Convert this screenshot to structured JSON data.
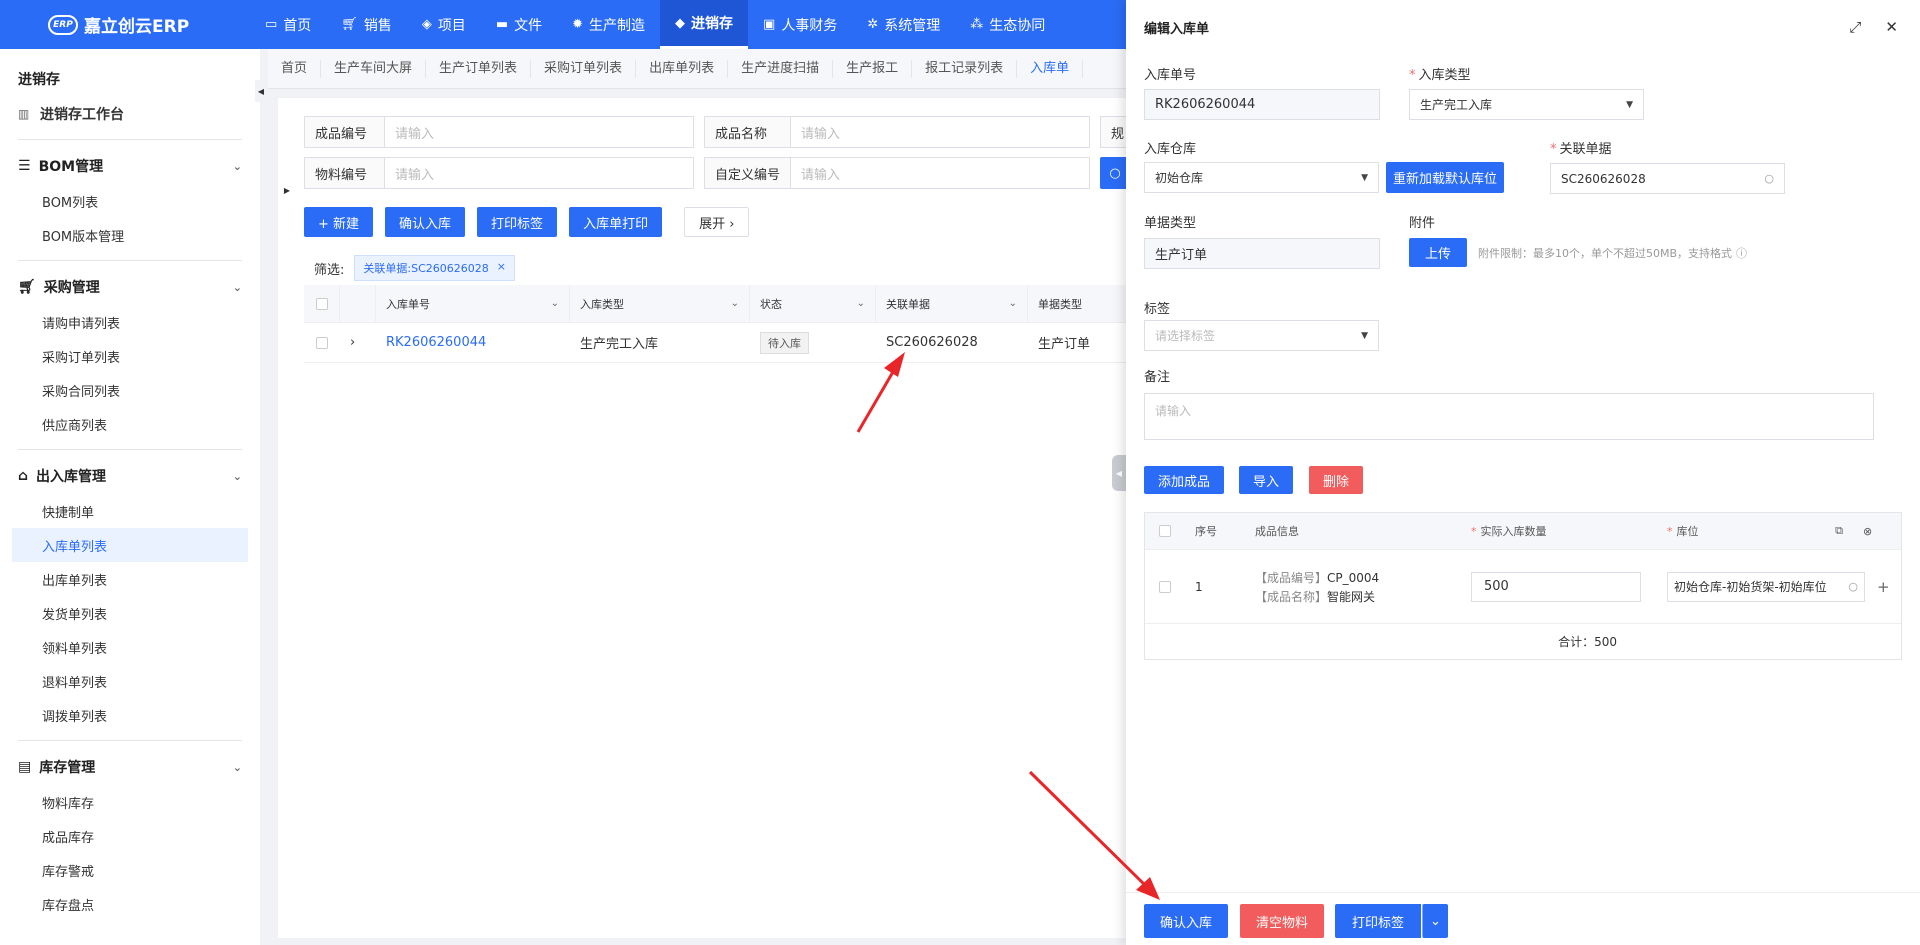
{
  "app": {
    "logo_badge": "ERP",
    "name": "嘉立创云ERP"
  },
  "topnav": [
    {
      "label": "首页",
      "icon": "monitor-icon"
    },
    {
      "label": "销售",
      "icon": "cart-icon"
    },
    {
      "label": "项目",
      "icon": "layers-icon"
    },
    {
      "label": "文件",
      "icon": "folder-icon"
    },
    {
      "label": "生产制造",
      "icon": "gear-icon"
    },
    {
      "label": "进销存",
      "icon": "box-icon",
      "active": true
    },
    {
      "label": "人事财务",
      "icon": "id-card-icon"
    },
    {
      "label": "系统管理",
      "icon": "settings-icon"
    },
    {
      "label": "生态协同",
      "icon": "nodes-icon"
    }
  ],
  "sidebar": {
    "title": "进销存",
    "workbench": "进销存工作台",
    "groups": [
      {
        "label": "BOM管理",
        "items": [
          "BOM列表",
          "BOM版本管理"
        ]
      },
      {
        "label": "采购管理",
        "items": [
          "请购申请列表",
          "采购订单列表",
          "采购合同列表",
          "供应商列表"
        ]
      },
      {
        "label": "出入库管理",
        "items": [
          "快捷制单",
          "入库单列表",
          "出库单列表",
          "发货单列表",
          "领料单列表",
          "退料单列表",
          "调拨单列表"
        ]
      },
      {
        "label": "库存管理",
        "items": [
          "物料库存",
          "成品库存",
          "库存警戒",
          "库存盘点"
        ]
      }
    ]
  },
  "tabs": [
    "首页",
    "生产车间大屏",
    "生产订单列表",
    "采购订单列表",
    "出库单列表",
    "生产进度扫描",
    "生产报工",
    "报工记录列表",
    "入库单"
  ],
  "search": {
    "product_code_label": "成品编号",
    "product_name_label": "成品名称",
    "spec_label": "规",
    "material_code_label": "物料编号",
    "custom_code_label": "自定义编号",
    "placeholder": "请输入"
  },
  "toolbar": {
    "new": "+ 新建",
    "confirm": "确认入库",
    "print_label": "打印标签",
    "print_doc": "入库单打印",
    "expand": "展开 ›"
  },
  "filter": {
    "label": "筛选:",
    "chip": "关联单据:SC260626028",
    "chip_close": "×"
  },
  "table": {
    "columns": [
      "入库单号",
      "入库类型",
      "状态",
      "关联单据",
      "单据类型"
    ],
    "rows": [
      {
        "no": "RK2606260044",
        "type": "生产完工入库",
        "status": "待入库",
        "related": "SC260626028",
        "doc_type": "生产订单"
      }
    ]
  },
  "drawer": {
    "title": "编辑入库单",
    "inbound_no_label": "入库单号",
    "inbound_no": "RK2606260044",
    "inbound_type_label": "入库类型",
    "inbound_type": "生产完工入库",
    "warehouse_label": "入库仓库",
    "warehouse": "初始仓库",
    "reload_btn": "重新加载默认库位",
    "related_label": "关联单据",
    "related": "SC260626028",
    "doc_type_label": "单据类型",
    "doc_type": "生产订单",
    "attach_label": "附件",
    "upload_btn": "上传",
    "attach_hint": "附件限制：最多10个，单个不超过50MB，支持格式",
    "tag_label": "标签",
    "tag_placeholder": "请选择标签",
    "remark_label": "备注",
    "remark_placeholder": "请输入",
    "add_btn": "添加成品",
    "import_btn": "导入",
    "delete_btn": "删除",
    "sub_columns": [
      "序号",
      "成品信息",
      "实际入库数量",
      "库位"
    ],
    "sub_rows": [
      {
        "seq": "1",
        "code_label": "【成品编号】",
        "code": "CP_0004",
        "name_label": "【成品名称】",
        "name": "智能网关",
        "qty": "500",
        "location": "初始仓库-初始货架-初始库位"
      }
    ],
    "total": "合计：500",
    "footer": {
      "confirm": "确认入库",
      "clear": "清空物料",
      "print": "打印标签"
    }
  },
  "colors": {
    "primary": "#2b6cf6",
    "danger": "#f25c5c",
    "arrow": "#e8262a"
  }
}
